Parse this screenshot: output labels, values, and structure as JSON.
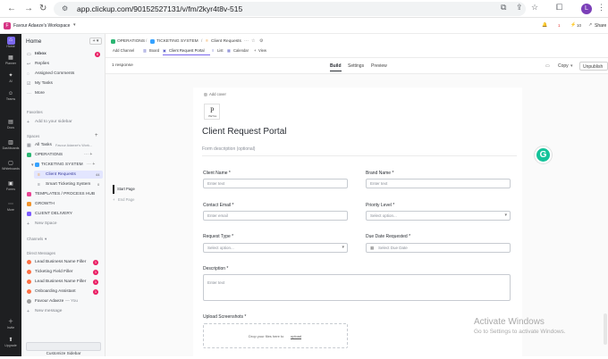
{
  "browser": {
    "url": "app.clickup.com/90152527131/v/fm/2kyr4t8v-515",
    "profile_initial": "L"
  },
  "workspace": {
    "name": "Favour Adaeze's Workspace",
    "badge": "F"
  },
  "topbar": {
    "badge_a": "1",
    "badge_b": "10",
    "share_label": "Share"
  },
  "rail": {
    "home": "Home",
    "planner": "Planner",
    "ai": "AI",
    "teams": "Teams",
    "docs": "Docs",
    "dashboards": "Dashboards",
    "whiteboards": "Whiteboards",
    "forms": "Forms",
    "more": "More",
    "invite": "Invite",
    "upgrade": "Upgrade"
  },
  "sidebar": {
    "title": "Home",
    "items": [
      {
        "label": "Inbox",
        "count": "8"
      },
      {
        "label": "Replies"
      },
      {
        "label": "Assigned Comments"
      },
      {
        "label": "My Tasks"
      },
      {
        "label": "More"
      }
    ],
    "favorites_header": "Favorites",
    "add_to_sidebar": "Add to your sidebar",
    "spaces_header": "Spaces",
    "all_tasks": "All Tasks",
    "all_tasks_ws": "Favour Adaeze's Work...",
    "spaces": [
      {
        "label": "OPERATIONS",
        "color": "#2bb673"
      },
      {
        "label": "TICKETING SYSTEM",
        "color": "#35a2ff"
      },
      {
        "label": "Client Requests",
        "count": "44"
      },
      {
        "label": "Smart Ticketing System",
        "count": "0"
      },
      {
        "label": "TEMPLATES / PROCESS HUB",
        "color": "#e84393"
      },
      {
        "label": "GROWTH",
        "color": "#f0932b"
      },
      {
        "label": "CLIENT DELIVERY",
        "color": "#7c5cff"
      }
    ],
    "new_space": "New Space",
    "channels_header": "Channels",
    "dm_header": "Direct Messages",
    "dms": [
      {
        "label": "Lead Business Name Filler",
        "count": "1"
      },
      {
        "label": "Ticketing Field Filler",
        "count": "1"
      },
      {
        "label": "Lead Business Name Filler",
        "count": "1"
      },
      {
        "label": "Onboarding Assistant",
        "count": "1"
      },
      {
        "label": "Favour Adaeze",
        "suffix": "You"
      }
    ],
    "new_message": "New message",
    "customize": "Customize Sidebar"
  },
  "breadcrumb": {
    "space": "OPERATIONS",
    "folder": "TICKETING SYSTEM",
    "list": "Client Requests"
  },
  "view_tabs": {
    "add_channel": "Add Channel",
    "tabs": [
      "Board",
      "Client Request Portal",
      "List",
      "Calendar"
    ],
    "add_view": "View"
  },
  "toolbar": {
    "responses": "1 response",
    "modes": [
      "Build",
      "Settings",
      "Preview"
    ],
    "active_mode": "Build",
    "copy": "Copy",
    "unpublish": "Unpublish"
  },
  "pages": {
    "start": "Start Page",
    "end": "End Page"
  },
  "form": {
    "add_cover": "Add cover",
    "logo_text": "PETAL",
    "title": "Client Request Portal",
    "description_placeholder": "Form description (optional)",
    "fields": {
      "client_name": {
        "label": "Client Name *",
        "placeholder": "Enter text"
      },
      "brand_name": {
        "label": "Brand Name *",
        "placeholder": "Enter text"
      },
      "contact_email": {
        "label": "Contact Email *",
        "placeholder": "Enter email"
      },
      "priority": {
        "label": "Priority Level *",
        "placeholder": "Select option..."
      },
      "request_type": {
        "label": "Request Type *",
        "placeholder": "Select option..."
      },
      "due_date": {
        "label": "Due Date Requested *",
        "placeholder": "Select Due Date"
      },
      "description": {
        "label": "Description *",
        "placeholder": "Enter text"
      },
      "upload": {
        "label": "Upload Screenshots *",
        "hint": "Drop your files here to",
        "link": "upload"
      }
    }
  },
  "watermark": {
    "title": "Activate Windows",
    "subtitle": "Go to Settings to activate Windows."
  }
}
